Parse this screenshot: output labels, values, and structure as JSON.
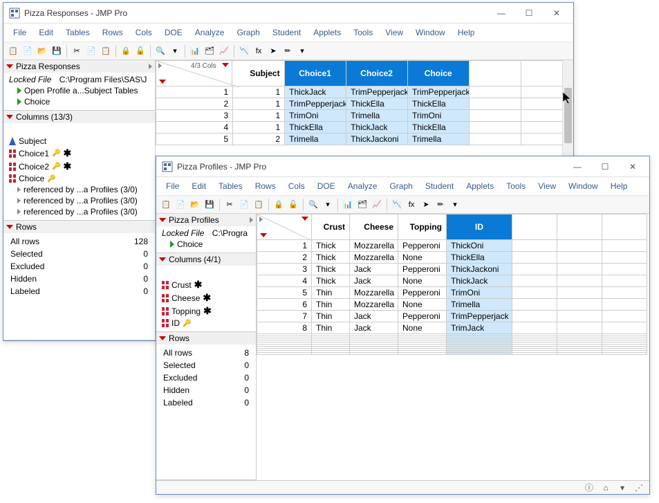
{
  "win1": {
    "title": "Pizza Responses - JMP Pro",
    "menus": [
      "File",
      "Edit",
      "Tables",
      "Rows",
      "Cols",
      "DOE",
      "Analyze",
      "Graph",
      "Student",
      "Applets",
      "Tools",
      "View",
      "Window",
      "Help"
    ],
    "panel_title": "Pizza Responses",
    "locked_label": "Locked File",
    "locked_path": "C:\\Program Files\\SAS\\J",
    "scripts": [
      "Open Profile a...Subject Tables",
      "Choice"
    ],
    "columns_hdr": "Columns (13/3)",
    "columns": [
      {
        "name": "Subject",
        "icon": "cont",
        "key": false,
        "star": false
      },
      {
        "name": "Choice1",
        "icon": "nom",
        "key": true,
        "star": true
      },
      {
        "name": "Choice2",
        "icon": "nom",
        "key": true,
        "star": true
      },
      {
        "name": "Choice",
        "icon": "nom",
        "key": true,
        "star": false
      }
    ],
    "refs": [
      "referenced by ...a Profiles (3/0)",
      "referenced by ...a Profiles (3/0)",
      "referenced by ...a Profiles (3/0)"
    ],
    "rows_hdr": "Rows",
    "rows_stats": [
      [
        "All rows",
        "128"
      ],
      [
        "Selected",
        "0"
      ],
      [
        "Excluded",
        "0"
      ],
      [
        "Hidden",
        "0"
      ],
      [
        "Labeled",
        "0"
      ]
    ],
    "cols_info": "4/3 Cols",
    "grid_headers": [
      "Subject",
      "Choice1",
      "Choice2",
      "Choice"
    ],
    "grid_sel": [
      false,
      true,
      true,
      true
    ],
    "grid_rows": [
      [
        "1",
        "1",
        "ThickJack",
        "TrimPepperjack",
        "TrimPepperjack"
      ],
      [
        "2",
        "1",
        "TrimPepperjack",
        "ThickElla",
        "ThickElla"
      ],
      [
        "3",
        "1",
        "TrimOni",
        "Trimella",
        "TrimOni"
      ],
      [
        "4",
        "1",
        "ThickElla",
        "ThickJack",
        "ThickElla"
      ],
      [
        "5",
        "2",
        "Trimella",
        "ThickJackoni",
        "Trimella"
      ]
    ]
  },
  "win2": {
    "title": "Pizza Profiles - JMP Pro",
    "menus": [
      "File",
      "Edit",
      "Tables",
      "Rows",
      "Cols",
      "DOE",
      "Analyze",
      "Graph",
      "Student",
      "Applets",
      "Tools",
      "View",
      "Window",
      "Help"
    ],
    "panel_title": "Pizza Profiles",
    "locked_label": "Locked File",
    "locked_path": "C:\\Progra",
    "scripts": [
      "Choice"
    ],
    "columns_hdr": "Columns (4/1)",
    "columns": [
      {
        "name": "Crust",
        "icon": "nom",
        "key": false,
        "star": true
      },
      {
        "name": "Cheese",
        "icon": "nom",
        "key": false,
        "star": true
      },
      {
        "name": "Topping",
        "icon": "nom",
        "key": false,
        "star": true
      },
      {
        "name": "ID",
        "icon": "nom",
        "key": true,
        "star": false
      }
    ],
    "rows_hdr": "Rows",
    "rows_stats": [
      [
        "All rows",
        "8"
      ],
      [
        "Selected",
        "0"
      ],
      [
        "Excluded",
        "0"
      ],
      [
        "Hidden",
        "0"
      ],
      [
        "Labeled",
        "0"
      ]
    ],
    "grid_headers": [
      "Crust",
      "Cheese",
      "Topping",
      "ID"
    ],
    "grid_sel": [
      false,
      false,
      false,
      true
    ],
    "grid_rows": [
      [
        "1",
        "Thick",
        "Mozzarella",
        "Pepperoni",
        "ThickOni"
      ],
      [
        "2",
        "Thick",
        "Mozzarella",
        "None",
        "ThickElla"
      ],
      [
        "3",
        "Thick",
        "Jack",
        "Pepperoni",
        "ThickJackoni"
      ],
      [
        "4",
        "Thick",
        "Jack",
        "None",
        "ThickJack"
      ],
      [
        "5",
        "Thin",
        "Mozzarella",
        "Pepperoni",
        "TrimOni"
      ],
      [
        "6",
        "Thin",
        "Mozzarella",
        "None",
        "Trimella"
      ],
      [
        "7",
        "Thin",
        "Jack",
        "Pepperoni",
        "TrimPepperjack"
      ],
      [
        "8",
        "Thin",
        "Jack",
        "None",
        "TrimJack"
      ]
    ]
  }
}
